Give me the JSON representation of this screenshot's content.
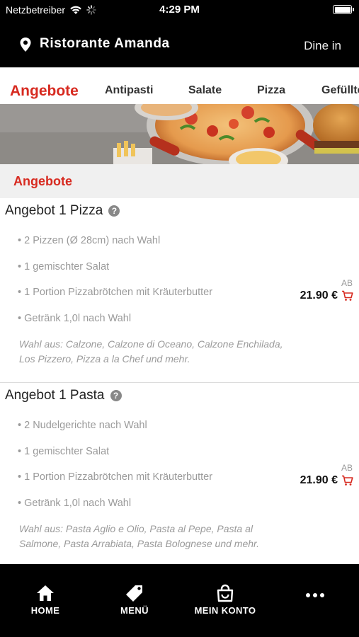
{
  "status_bar": {
    "carrier": "Netzbetreiber",
    "time": "4:29 PM"
  },
  "header": {
    "restaurant": "Ristorante Amanda",
    "mode": "Dine in"
  },
  "tabs": [
    {
      "label": "Angebote",
      "active": true
    },
    {
      "label": "Antipasti",
      "active": false
    },
    {
      "label": "Salate",
      "active": false
    },
    {
      "label": "Pizza",
      "active": false
    },
    {
      "label": "Gefüllte",
      "active": false
    }
  ],
  "section": {
    "title": "Angebote"
  },
  "offers": [
    {
      "title": "Angebot 1 Pizza",
      "items": [
        "• 2 Pizzen (Ø 28cm) nach Wahl",
        "• 1 gemischter Salat",
        "• 1 Portion Pizzabrötchen mit Kräuterbutter",
        "• Getränk 1,0l nach Wahl"
      ],
      "note": "Wahl aus: Calzone, Calzone di Oceano, Calzone Enchilada, Los Pizzero, Pizza a la Chef und mehr.",
      "price_prefix": "AB",
      "price": "21.90 €"
    },
    {
      "title": "Angebot 1 Pasta",
      "items": [
        "• 2 Nudelgerichte nach Wahl",
        "• 1 gemischter Salat",
        "• 1 Portion Pizzabrötchen mit Kräuterbutter",
        "• Getränk 1,0l nach Wahl"
      ],
      "note": "Wahl aus: Pasta Aglio e Olio, Pasta al Pepe, Pasta al Salmone, Pasta Arrabiata, Pasta Bolognese und mehr.",
      "price_prefix": "AB",
      "price": "21.90 €"
    }
  ],
  "bottom_nav": [
    {
      "label": "HOME",
      "icon": "home-icon"
    },
    {
      "label": "MENÜ",
      "icon": "tag-icon"
    },
    {
      "label": "MEIN KONTO",
      "icon": "shopping-bag-icon"
    },
    {
      "label": "",
      "icon": "more-icon"
    }
  ],
  "colors": {
    "accent": "#d72a20",
    "bar_background": "#000000",
    "section_background": "#f0f0f0"
  }
}
